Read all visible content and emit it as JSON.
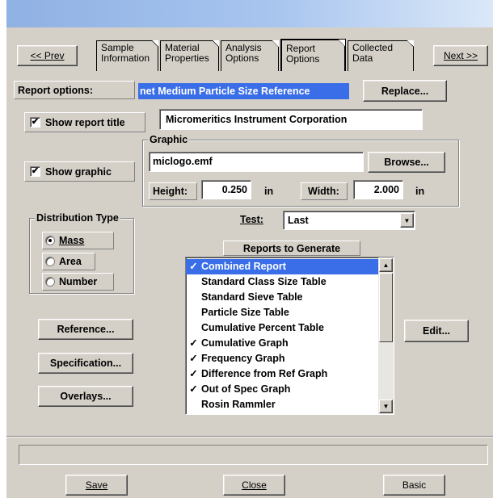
{
  "nav": {
    "prev_label": "<< Prev",
    "next_label": "Next >>",
    "tabs": [
      {
        "line1": "Sample",
        "line2": "Information"
      },
      {
        "line1": "Material",
        "line2": "Properties"
      },
      {
        "line1": "Analysis",
        "line2": "Options"
      },
      {
        "line1": "Report",
        "line2": "Options"
      },
      {
        "line1": "Collected",
        "line2": "Data"
      }
    ],
    "active_tab": "Report Options"
  },
  "report_options": {
    "label": "Report options:",
    "value": "net Medium Particle Size Reference",
    "replace_label": "Replace..."
  },
  "show_report_title": {
    "label": "Show report title",
    "checked": true,
    "value": "Micromeritics Instrument Corporation"
  },
  "graphic": {
    "group_title": "Graphic",
    "show_label": "Show graphic",
    "checked": true,
    "file": "miclogo.emf",
    "browse_label": "Browse...",
    "height_label": "Height:",
    "height_value": "0.250",
    "height_unit": "in",
    "width_label": "Width:",
    "width_value": "2.000",
    "width_unit": "in"
  },
  "distribution": {
    "title": "Distribution Type",
    "options": [
      "Mass",
      "Area",
      "Number"
    ],
    "selected": "Mass"
  },
  "test": {
    "label": "Test:",
    "value": "Last"
  },
  "reports": {
    "title": "Reports to Generate",
    "items": [
      {
        "label": "Combined Report",
        "checked": true,
        "selected": true
      },
      {
        "label": "Standard Class Size Table",
        "checked": false,
        "selected": false
      },
      {
        "label": "Standard Sieve Table",
        "checked": false,
        "selected": false
      },
      {
        "label": "Particle Size Table",
        "checked": false,
        "selected": false
      },
      {
        "label": "Cumulative Percent Table",
        "checked": false,
        "selected": false
      },
      {
        "label": "Cumulative Graph",
        "checked": true,
        "selected": false
      },
      {
        "label": "Frequency Graph",
        "checked": true,
        "selected": false
      },
      {
        "label": "Difference from Ref Graph",
        "checked": true,
        "selected": false
      },
      {
        "label": "Out of Spec Graph",
        "checked": true,
        "selected": false
      },
      {
        "label": "Rosin Rammler",
        "checked": false,
        "selected": false
      }
    ],
    "check_glyph": "✓"
  },
  "side_buttons": {
    "reference": "Reference...",
    "specification": "Specification...",
    "overlays": "Overlays...",
    "edit": "Edit..."
  },
  "status_text": "",
  "footer": {
    "save": "Save",
    "close": "Close",
    "basic": "Basic"
  },
  "colors": {
    "face": "#d4d0c8",
    "selection": "#3a6ee8",
    "titlebar_start": "#8fb1e3"
  }
}
